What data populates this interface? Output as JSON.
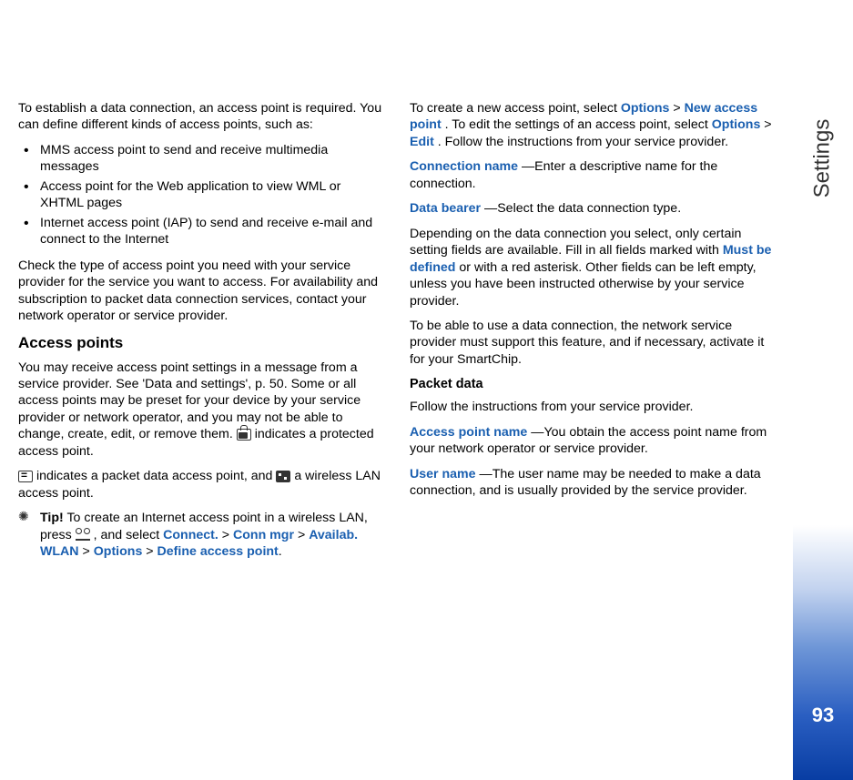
{
  "sidebar": {
    "label": "Settings",
    "page_number": "93"
  },
  "col1": {
    "intro": "To establish a data connection, an access point is required. You can define different kinds of access points, such as:",
    "bullets": [
      "MMS access point to send and receive multimedia messages",
      "Access point for the Web application to view WML or XHTML pages",
      "Internet access point (IAP) to send and receive e-mail and connect to the Internet"
    ],
    "check": "Check the type of access point you need with your service provider for the service you want to access. For availability and subscription to packet data connection services, contact your network operator or service provider.",
    "section": "Access points",
    "receive_pre": "You may receive access point settings in a message from a service provider. See 'Data and settings', p. 50. Some or all access points may be preset for your device by your service provider or network operator, and you may not be able to change, create, edit, or remove them. ",
    "receive_post": " indicates a protected access point.",
    "icons_pre": "",
    "icons_mid1": " indicates a packet data access point, and ",
    "icons_post": " a wireless LAN access point.",
    "tip_bold": "Tip!",
    "tip_text_pre": " To create an Internet access point in a wireless LAN, press ",
    "tip_text_mid": " , and select ",
    "tip_connect": "Connect.",
    "tip_connmgr": "Conn mgr",
    "tip_availab": "Availab. WLAN",
    "tip_options": "Options",
    "tip_define": "Define access point",
    "gt": " > "
  },
  "col2": {
    "create_pre": "To create a new access point, select ",
    "create_options": "Options",
    "create_newap": "New access point",
    "create_mid": ". To edit the settings of an access point, select ",
    "create_options2": "Options",
    "create_edit": "Edit",
    "create_post": ". Follow the instructions from your service provider.",
    "conn_name": "Connection name",
    "conn_name_text": "—Enter a descriptive name for the connection.",
    "data_bearer": "Data bearer",
    "data_bearer_text": "—Select the data connection type.",
    "depending_pre": "Depending on the data connection you select, only certain setting fields are available. Fill in all fields marked with ",
    "must_be": "Must be defined",
    "depending_post": " or with a red asterisk. Other fields can be left empty, unless you have been instructed otherwise by your service provider.",
    "use_conn": "To be able to use a data connection, the network service provider must support this feature, and if necessary, activate it for your SmartChip.",
    "packet_data": "Packet data",
    "packet_text": "Follow the instructions from your service provider.",
    "apn": "Access point name",
    "apn_text": "—You obtain the access point name from your network operator or service provider.",
    "username": "User name",
    "username_text": "—The user name may be needed to make a data connection, and is usually provided by the service provider."
  }
}
